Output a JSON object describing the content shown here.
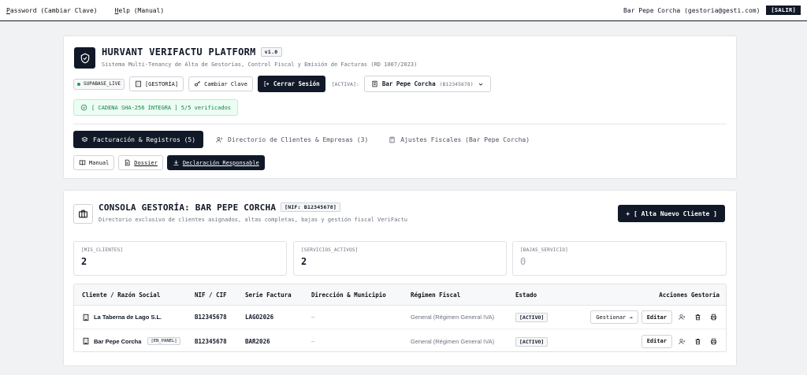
{
  "menubar": {
    "password_label": "Password (Cambiar Clave)",
    "password_key": "P",
    "password_rest": "assword (Cambiar Clave)",
    "help_key": "H",
    "help_rest": "elp (Manual)",
    "user": "Bar Pepe Corcha (gestoria@gesti.com)",
    "logout_label": "[SALIR]"
  },
  "header": {
    "title": "HURVANT VERIFACTU PLATFORM",
    "version": "v1.0",
    "subtitle": "Sistema Multi-Tenancy de Alta de Gestorias, Control Fiscal y Emisión de Facturas (RD 1007/2023)"
  },
  "controls": {
    "env_badge": "SUPABASE_LIVE",
    "role_button": "[GESTORÍA]",
    "change_password": "Cambiar Clave",
    "logout": "Cerrar Sesión",
    "active_label": "[ACTIVA]:",
    "active_company": "Bar Pepe Corcha",
    "active_nif": "(B12345678)"
  },
  "chain": {
    "label": "[ CADENA SHA-256 ÍNTEGRA ] 5/5 verificados"
  },
  "tabs": [
    {
      "label": "Facturación & Registros (5)"
    },
    {
      "label": "Directorio de Clientes & Empresas (3)"
    },
    {
      "label": "Ajustes Fiscales (Bar Pepe Corcha)"
    }
  ],
  "docs": {
    "manual": "Manual",
    "dossier": "Dossier",
    "declaracion": "Declaración Responsable"
  },
  "console": {
    "title": "CONSOLA GESTORÍA: BAR PEPE CORCHA",
    "nif_badge": "[NIF: B12345678]",
    "subtitle": "Directorio exclusivo de clientes asignados, altas completas, bajas y gestión fiscal VeriFactu",
    "add_button": "[ Alta Nuevo Cliente ]"
  },
  "stats": [
    {
      "label": "[MIS_CLIENTES]",
      "value": "2"
    },
    {
      "label": "[SERVICIOS_ACTIVOS]",
      "value": "2"
    },
    {
      "label": "[BAJAS_SERVICIO]",
      "value": "0"
    }
  ],
  "table": {
    "headers": [
      "Cliente / Razón Social",
      "NIF / CIF",
      "Serie Factura",
      "Dirección & Municipio",
      "Régimen Fiscal",
      "Estado",
      "Acciones Gestoría"
    ],
    "rows": [
      {
        "cliente": "La Taberna de Lago S.L.",
        "badge": "",
        "nif": "B12345678",
        "serie": "LAGO2026",
        "direccion": "—",
        "regimen": "General (Régimen General IVA)",
        "estado": "[ACTIVO]",
        "gestionar": "Gestionar →",
        "editar": "Editar"
      },
      {
        "cliente": "Bar Pepe Corcha",
        "badge": "[EN_PANEL]",
        "nif": "B12345678",
        "serie": "BAR2026",
        "direccion": "—",
        "regimen": "General (Régimen General IVA)",
        "estado": "[ACTIVO]",
        "gestionar": "",
        "editar": "Editar"
      }
    ]
  }
}
